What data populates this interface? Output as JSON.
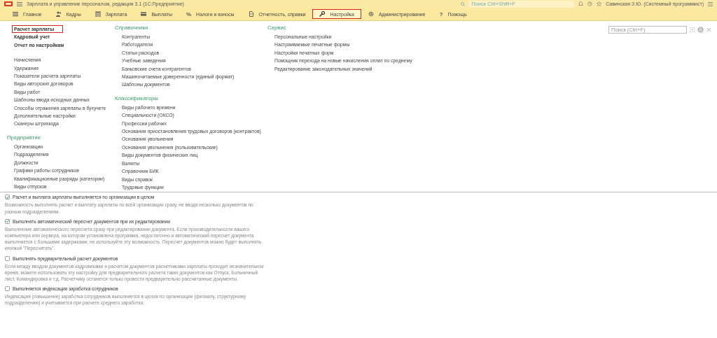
{
  "window": {
    "title": "Зарплата и управление персоналом, редакция 3.1  (1С:Предприятие)",
    "search": {
      "placeholder": "Поиск Ctrl+Shift+F"
    },
    "user": "Савинская З.Ю. (Системный программист)"
  },
  "nav": [
    {
      "label": "Главное",
      "selected": false
    },
    {
      "label": "Кадры",
      "selected": false
    },
    {
      "label": "Зарплата",
      "selected": false
    },
    {
      "label": "Выплаты",
      "selected": false
    },
    {
      "label": "Налоги и взносы",
      "selected": false,
      "glyph": "%"
    },
    {
      "label": "Отчетность, справки",
      "selected": false
    },
    {
      "label": "Настройка",
      "selected": true
    },
    {
      "label": "Администрирование",
      "selected": false
    },
    {
      "label": "Помощь",
      "selected": false,
      "glyph": "?"
    }
  ],
  "panel": {
    "search": {
      "placeholder": "Поиск (Ctrl+F)"
    },
    "columns": [
      {
        "sections": [
          {
            "items": [
              {
                "label": "Расчет зарплаты",
                "kind": "bold",
                "highlighted": true
              },
              {
                "label": "Кадровый учет",
                "kind": "bold",
                "highlighted": false
              },
              {
                "label": "Отчет по настройкам",
                "kind": "bold",
                "highlighted": false
              }
            ]
          },
          {
            "items": [
              {
                "label": "Начисления",
                "kind": "plain",
                "highlighted": false
              },
              {
                "label": "Удержания",
                "kind": "plain",
                "highlighted": false
              },
              {
                "label": "Показатели расчета зарплаты",
                "kind": "plain",
                "highlighted": false
              },
              {
                "label": "Виды авторских договоров",
                "kind": "plain",
                "highlighted": false
              },
              {
                "label": "Виды работ",
                "kind": "plain",
                "highlighted": false
              },
              {
                "label": "Шаблоны ввода исходных данных",
                "kind": "plain",
                "highlighted": false
              },
              {
                "label": "Способы отражения зарплаты в бухучете",
                "kind": "plain",
                "highlighted": false
              },
              {
                "label": "Дополнительные настройки",
                "kind": "plain",
                "highlighted": false
              },
              {
                "label": "Сканеры штрихкода",
                "kind": "plain",
                "highlighted": false
              }
            ]
          },
          {
            "heading": "Предприятие",
            "items": [
              {
                "label": "Организации",
                "kind": "plain",
                "highlighted": false
              },
              {
                "label": "Подразделения",
                "kind": "plain",
                "highlighted": false
              },
              {
                "label": "Должности",
                "kind": "plain",
                "highlighted": false
              },
              {
                "label": "Графики работы сотрудников",
                "kind": "plain",
                "highlighted": false
              },
              {
                "label": "Квалификационные разряды (категории)",
                "kind": "plain",
                "highlighted": false
              },
              {
                "label": "Виды отпусков",
                "kind": "plain",
                "highlighted": false
              }
            ]
          }
        ]
      },
      {
        "sections": [
          {
            "heading": "Справочники",
            "items": [
              {
                "label": "Контрагенты",
                "kind": "plain",
                "highlighted": false
              },
              {
                "label": "Работодатели",
                "kind": "plain",
                "highlighted": false
              },
              {
                "label": "Статьи расходов",
                "kind": "plain",
                "highlighted": false
              },
              {
                "label": "Учебные заведения",
                "kind": "plain",
                "highlighted": false
              },
              {
                "label": "Банковские счета контрагентов",
                "kind": "plain",
                "highlighted": false
              },
              {
                "label": "Машиночитаемые доверенности (единый формат)",
                "kind": "plain",
                "highlighted": false
              },
              {
                "label": "Шаблоны документов",
                "kind": "plain",
                "highlighted": false
              }
            ]
          },
          {
            "heading": "Классификаторы",
            "items": [
              {
                "label": "Виды рабочего времени",
                "kind": "plain",
                "highlighted": false
              },
              {
                "label": "Специальности (ОКСО)",
                "kind": "plain",
                "highlighted": false
              },
              {
                "label": "Профессии рабочих",
                "kind": "plain",
                "highlighted": false
              },
              {
                "label": "Основания приостановления трудовых договоров (контрактов)",
                "kind": "plain",
                "highlighted": false
              },
              {
                "label": "Основания увольнения",
                "kind": "plain",
                "highlighted": false
              },
              {
                "label": "Основания увольнения (пользовательские)",
                "kind": "plain",
                "highlighted": false
              },
              {
                "label": "Виды документов физических лиц",
                "kind": "plain",
                "highlighted": false
              },
              {
                "label": "Валюты",
                "kind": "plain",
                "highlighted": false
              },
              {
                "label": "Справочник БИК",
                "kind": "plain",
                "highlighted": false
              },
              {
                "label": "Виды справок",
                "kind": "plain",
                "highlighted": false
              },
              {
                "label": "Трудовые функции",
                "kind": "plain",
                "highlighted": false
              }
            ]
          }
        ]
      },
      {
        "sections": [
          {
            "heading": "Сервис",
            "items": [
              {
                "label": "Персональные настройки",
                "kind": "plain",
                "highlighted": false
              },
              {
                "label": "Настраиваемые печатные формы",
                "kind": "plain",
                "highlighted": false
              },
              {
                "label": "Настройки печатных форм",
                "kind": "plain",
                "highlighted": false
              },
              {
                "label": "Помощник перехода на новые начисления оплат по среднему",
                "kind": "plain",
                "highlighted": false
              },
              {
                "label": "Редактирование законодательных значений",
                "kind": "plain",
                "highlighted": false
              }
            ]
          }
        ]
      }
    ]
  },
  "settings": [
    {
      "label": "Расчет и выплата зарплаты выполняется по организации в целом",
      "checked": true,
      "description": "Возможность выполнять расчет и выплату зарплаты по всей организации сразу, не вводя несколько документов по разным подразделениям."
    },
    {
      "label": "Выполнять автоматический пересчет документов при их редактировании",
      "checked": true,
      "description": "Выполнение автоматического пересчета сразу при редактировании документа. Если производительности вашего компьютера или сервера, на котором установлена программа, недостаточно и автоматический пересчет документа выполняется с большими задержками, не используйте эту возможность. Пересчет документов можно будет выполнять кнопкой \"Пересчитать\"."
    },
    {
      "label": "Выполнять предварительный расчет документов",
      "checked": false,
      "description": "Если между вводом документов кадровиками и расчетом документов расчетчиками зарплаты проходит незначительное время, можете использовать эту настройку для предварительного расчета таких документов как Отпуск, Больничный лист, Командировка и т.д. Расчетчику останется только провести предварительно рассчитанные документы."
    },
    {
      "label": "Выполняется индексация заработка сотрудников",
      "checked": false,
      "description": "Индексация (повышение) заработка сотрудников выполняется в целом по организации (филиалу, структурному подразделению) и учитывается при расчете среднего заработка."
    }
  ]
}
